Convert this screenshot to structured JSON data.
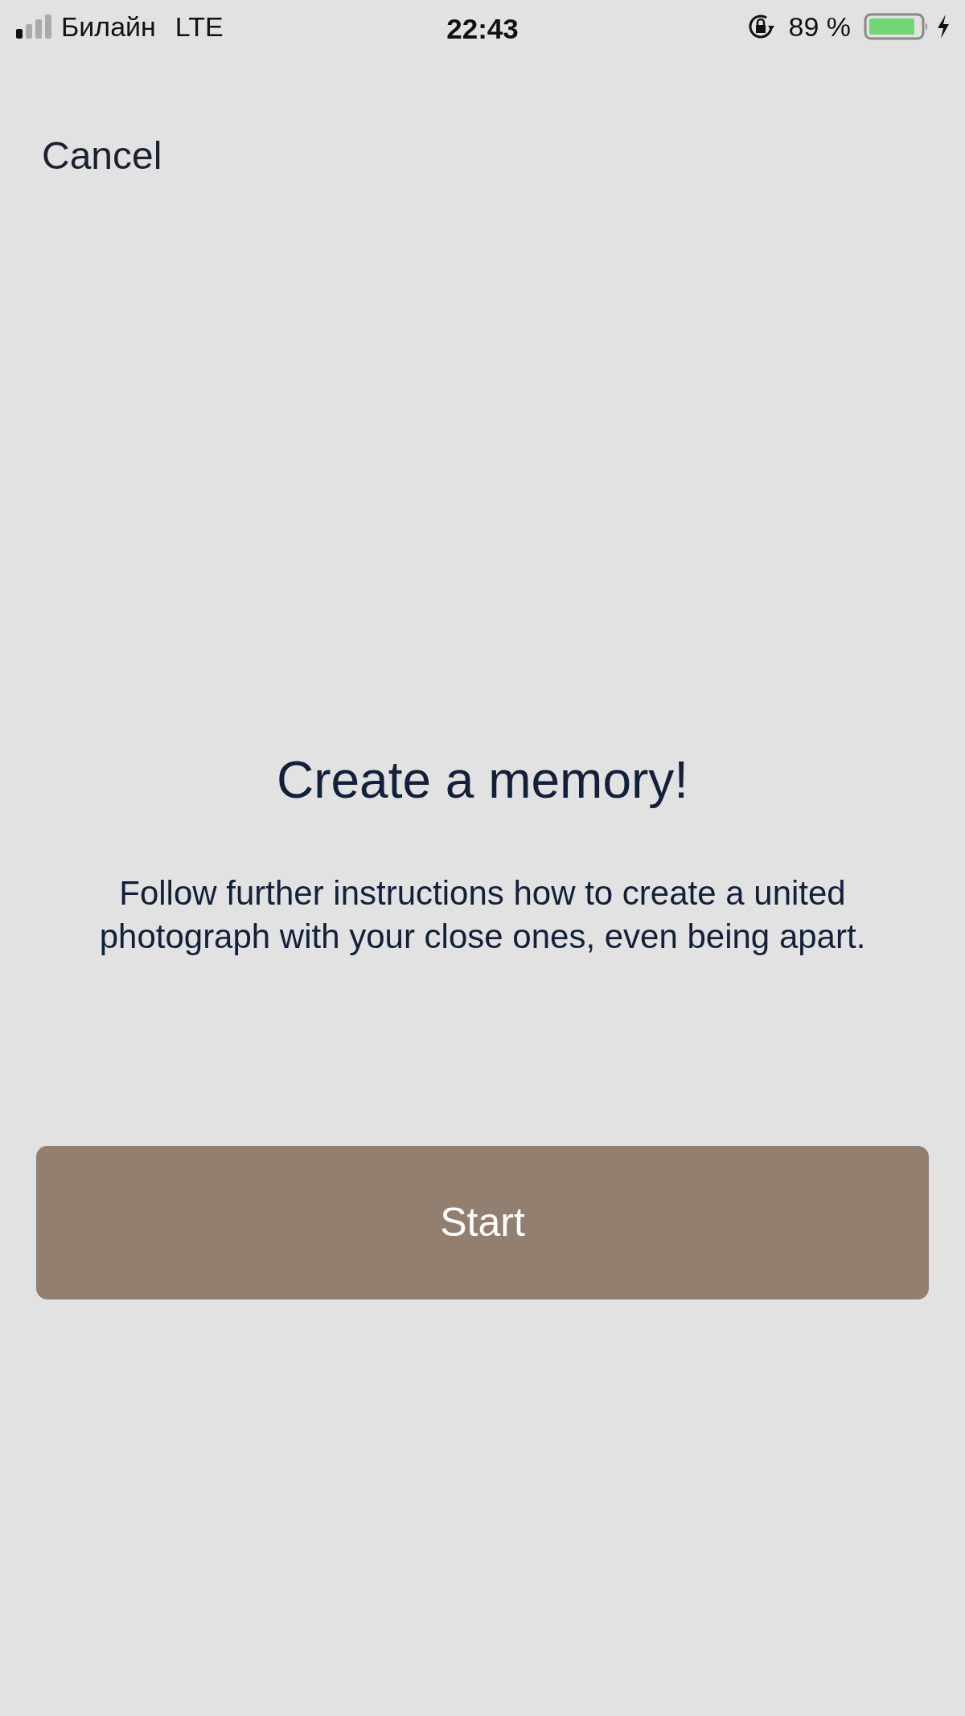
{
  "status_bar": {
    "carrier": "Билайн",
    "network": "LTE",
    "time": "22:43",
    "battery": "89 %"
  },
  "nav": {
    "cancel": "Cancel"
  },
  "title": "Create a memory!",
  "description": "Follow further instructions how to create a united photograph with your close ones, even being apart.",
  "button": "Start"
}
